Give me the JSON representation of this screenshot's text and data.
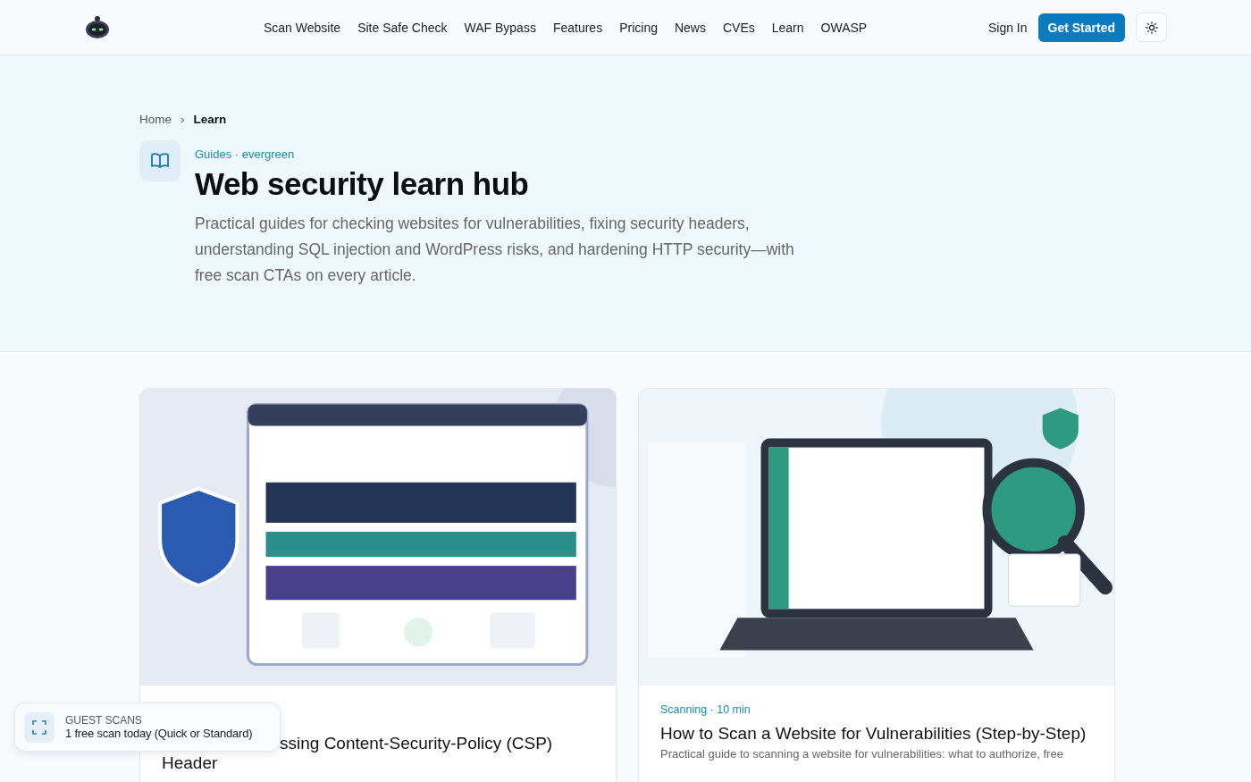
{
  "nav": {
    "links": [
      {
        "label": "Scan Website",
        "selected": false
      },
      {
        "label": "Site Safe Check",
        "selected": false
      },
      {
        "label": "WAF Bypass",
        "selected": false
      },
      {
        "label": "Features",
        "selected": false
      },
      {
        "label": "Pricing",
        "selected": false
      },
      {
        "label": "News",
        "selected": false
      },
      {
        "label": "CVEs",
        "selected": false
      },
      {
        "label": "Learn",
        "selected": false
      },
      {
        "label": "OWASP",
        "selected": false
      }
    ],
    "sign_in": "Sign In",
    "cta": "Get Started"
  },
  "breadcrumb": {
    "items": [
      "Home",
      "Learn"
    ],
    "separator": "›"
  },
  "hero": {
    "eyebrow": "Guides · evergreen",
    "title": "Web security learn hub",
    "description": "Practical guides for checking websites for vulnerabilities, fixing security headers, understanding SQL injection and WordPress risks, and hardening HTTP security—with free scan CTAs on every article."
  },
  "cards": [
    {
      "title_lines": [
        "ssing Content-Security-Policy (CSP)",
        "Header"
      ]
    },
    {
      "meta": "Scanning · 10 min",
      "title": "How to Scan a Website for Vulnerabilities (Step-by-Step)",
      "description": "Practical guide to scanning a website for vulnerabilities: what to authorize, free"
    }
  ],
  "toast": {
    "label": "GUEST SCANS",
    "text": "1 free scan today (Quick or Standard)"
  }
}
